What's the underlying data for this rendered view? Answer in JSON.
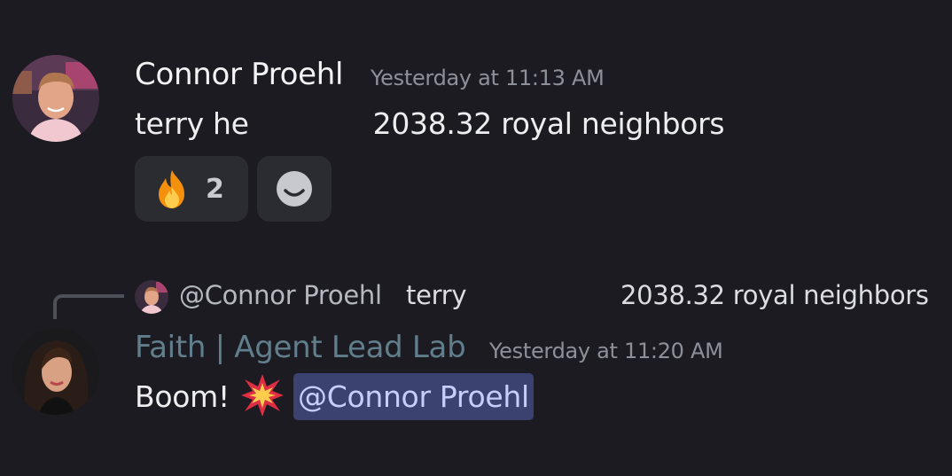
{
  "message1": {
    "author": "Connor Proehl",
    "timestamp": "Yesterday at 11:13 AM",
    "text_start": "terry he",
    "text_end": "2038.32 royal neighbors",
    "avatar_icon": "user-photo-icon",
    "reactions": [
      {
        "emoji": "🔥",
        "emoji_icon": "fire-icon",
        "count": "2"
      }
    ],
    "add_reaction_icon": "smiley-add-reaction-icon"
  },
  "message2": {
    "reply": {
      "author": "@Connor Proehl",
      "text_start": "terry",
      "text_end": "2038.32 royal neighbors"
    },
    "author": "Faith | Agent Lead Lab",
    "author_color": "#617e8c",
    "timestamp": "Yesterday at 11:20 AM",
    "text": "Boom!",
    "emoji": "💥",
    "emoji_icon": "collision-icon",
    "mention": "@Connor Proehl",
    "avatar_icon": "user-photo-icon"
  },
  "colors": {
    "background": "#1c1b21",
    "timestamp": "#8e9099",
    "mention_bg": "#3c4270",
    "mention_fg": "#c9cdfb",
    "reaction_bg": "#2b2c32"
  }
}
